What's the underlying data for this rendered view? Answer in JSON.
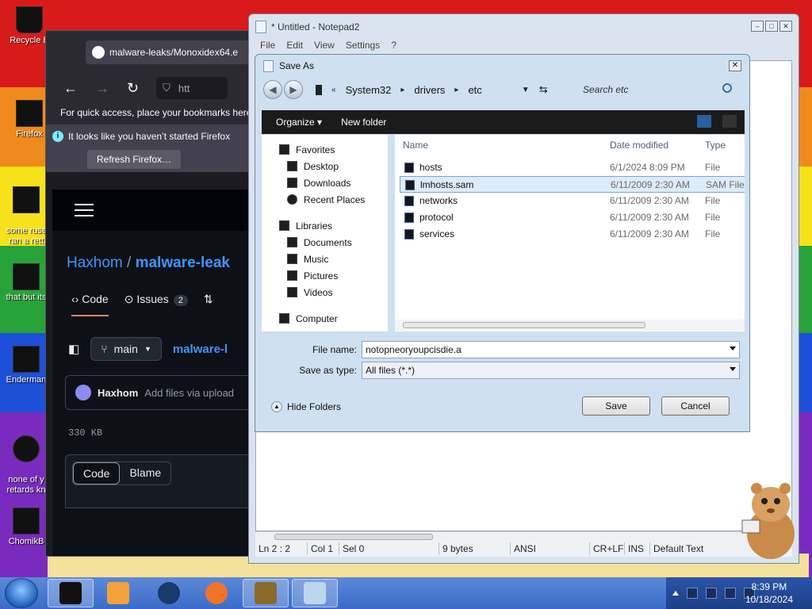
{
  "desktop": {
    "icons": [
      {
        "label": "Recycle B"
      },
      {
        "label": "Firefox"
      },
      {
        "label": "some russ\nran a rett"
      },
      {
        "label": "that but its"
      },
      {
        "label": "Enderman"
      },
      {
        "label": "none of y\nretards kn"
      },
      {
        "label": "ChomikB"
      }
    ]
  },
  "firefox": {
    "tab_title": "malware-leaks/Monoxidex64.e",
    "url_partial": "htt",
    "bookmarks_text": "For quick access, place your bookmarks here",
    "notice_text": "It looks like you haven’t started Firefox",
    "refresh_button": "Refresh Firefox…",
    "github": {
      "owner": "Haxhom",
      "separator": "/",
      "repo": "malware-leak",
      "tabs": [
        {
          "label": "Code"
        },
        {
          "label": "Issues",
          "badge": "2"
        }
      ],
      "branch": "main",
      "file_path": "malware-l",
      "commit_author": "Haxhom",
      "commit_message": "Add files via upload",
      "file_size": "330 KB",
      "view_code": "Code",
      "view_blame": "Blame"
    }
  },
  "notepad": {
    "title": "* Untitled - Notepad2",
    "menu": [
      "File",
      "Edit",
      "View",
      "Settings",
      "?"
    ],
    "status": {
      "position": "Ln 2 : 2",
      "col": "Col 1",
      "sel": "Sel 0",
      "size": "9 bytes",
      "encoding": "ANSI",
      "line_endings": "CR+LF",
      "insert_mode": "INS",
      "scheme": "Default Text"
    }
  },
  "saveas": {
    "title": "Save As",
    "breadcrumb": [
      "System32",
      "drivers",
      "etc"
    ],
    "search_placeholder": "Search etc",
    "toolbar": {
      "organize": "Organize ▾",
      "new_folder": "New folder"
    },
    "nav": {
      "favorites": "Favorites",
      "favorites_items": [
        "Desktop",
        "Downloads",
        "Recent Places"
      ],
      "libraries": "Libraries",
      "libraries_items": [
        "Documents",
        "Music",
        "Pictures",
        "Videos"
      ],
      "computer": "Computer"
    },
    "columns": {
      "name": "Name",
      "date": "Date modified",
      "type": "Type"
    },
    "files": [
      {
        "name": "hosts",
        "date": "6/1/2024 8:09 PM",
        "type": "File"
      },
      {
        "name": "lmhosts.sam",
        "date": "6/11/2009 2:30 AM",
        "type": "SAM File"
      },
      {
        "name": "networks",
        "date": "6/11/2009 2:30 AM",
        "type": "File"
      },
      {
        "name": "protocol",
        "date": "6/11/2009 2:30 AM",
        "type": "File"
      },
      {
        "name": "services",
        "date": "6/11/2009 2:30 AM",
        "type": "File"
      }
    ],
    "selected_index": 1,
    "file_name_label": "File name:",
    "file_name_value": "notopneoryoupcisdie.a",
    "save_as_type_label": "Save as type:",
    "save_as_type_value": "All files (*.*)",
    "hide_folders": "Hide Folders",
    "save_button": "Save",
    "cancel_button": "Cancel"
  },
  "taskbar": {
    "time": "8:39 PM",
    "date": "10/18/2024"
  },
  "colors": {
    "taskbar": "#3a6bc8",
    "dialog_bg": "#cfe0f1",
    "selection": "#dcecfc",
    "github_link": "#4493f8"
  }
}
